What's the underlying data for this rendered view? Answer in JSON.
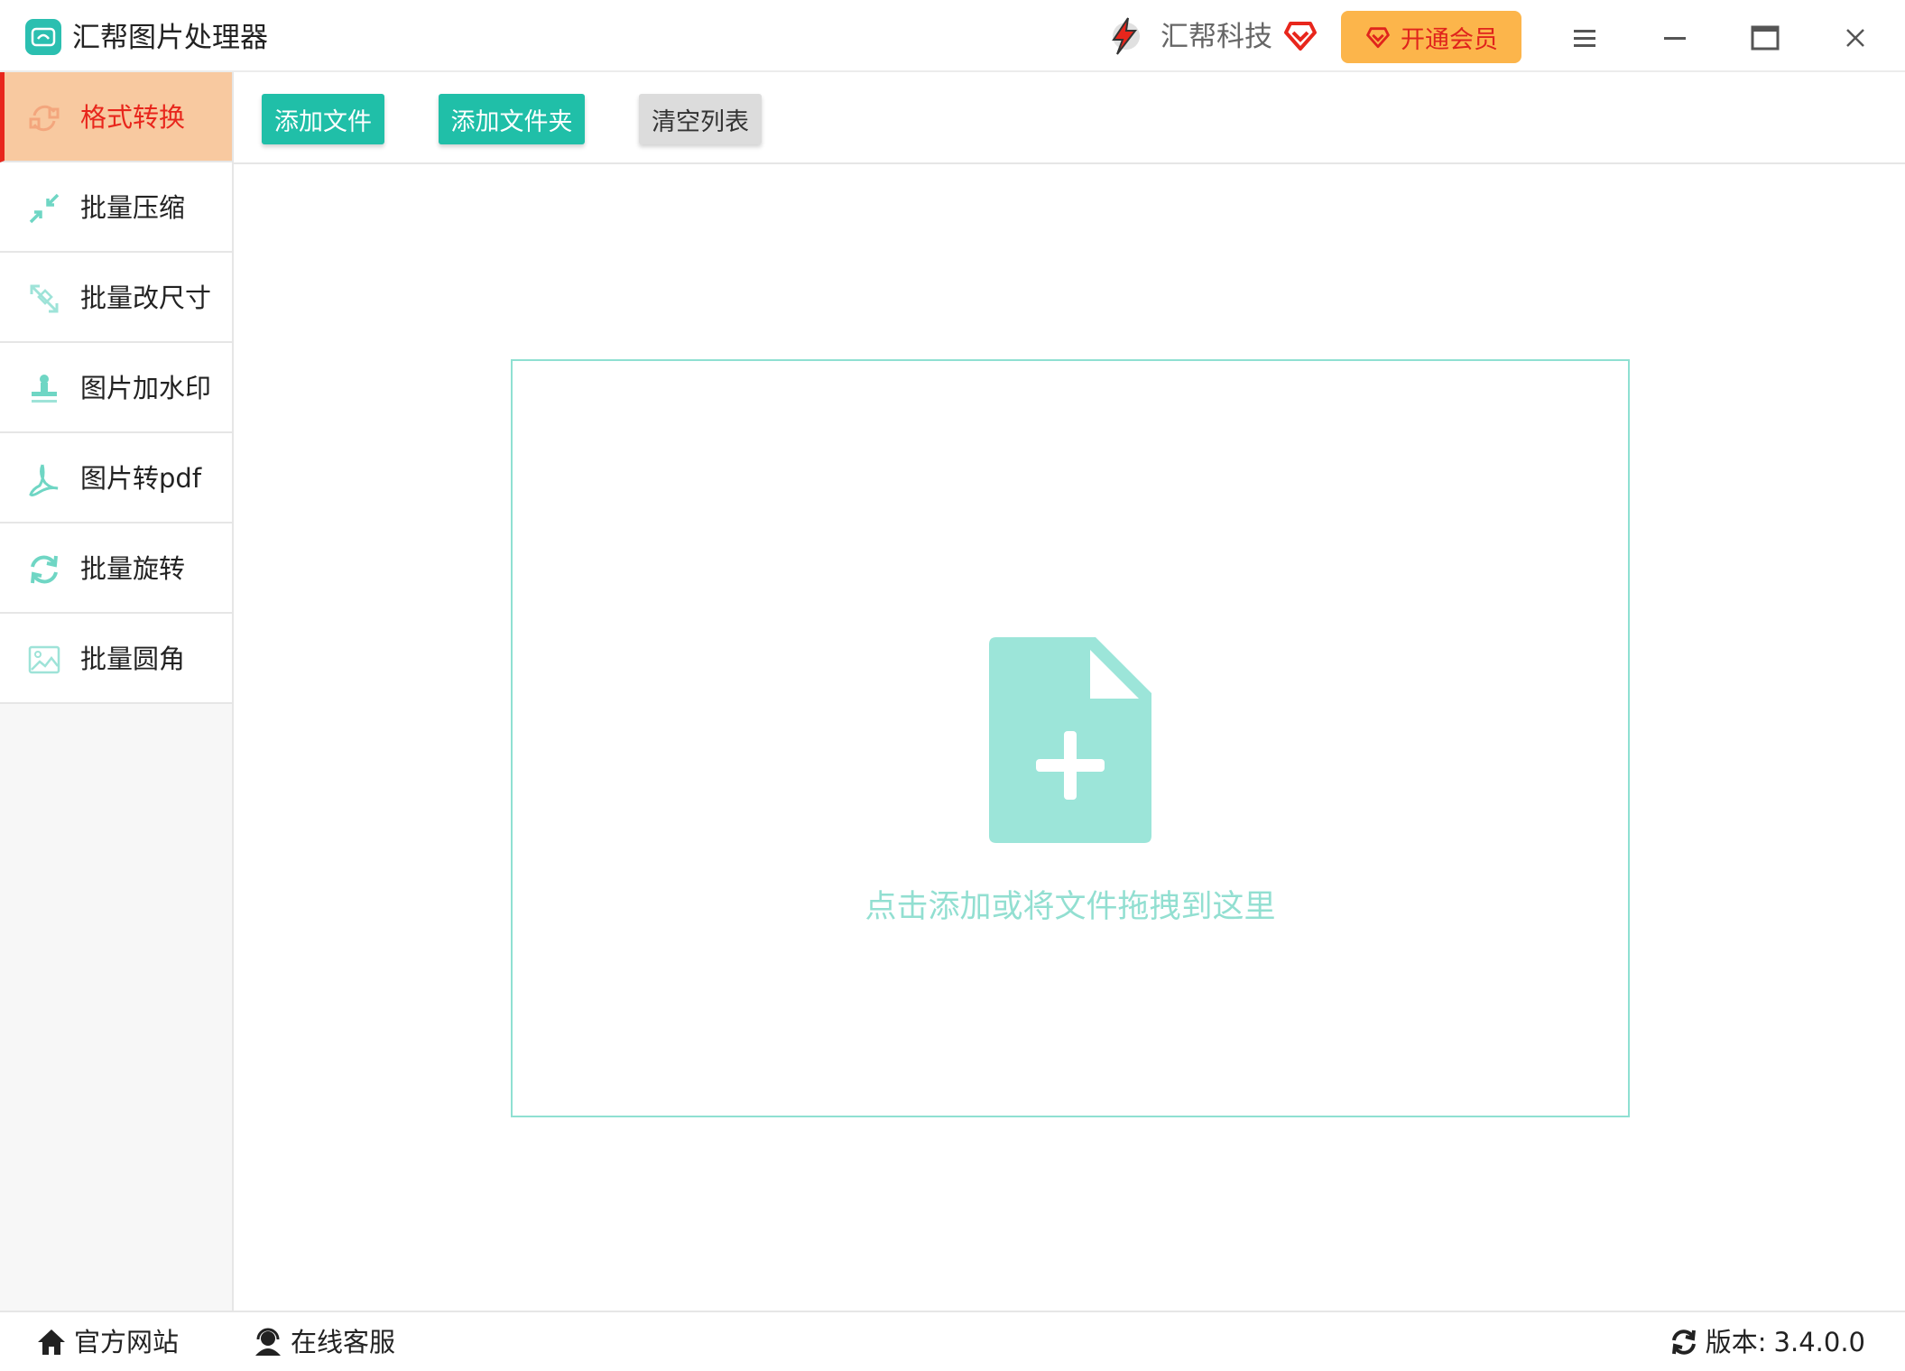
{
  "window": {
    "title": "汇帮图片处理器",
    "brand": "汇帮科技",
    "vip_label": "开通会员"
  },
  "sidebar": {
    "items": [
      {
        "label": "格式转换",
        "icon": "convert-icon",
        "active": true
      },
      {
        "label": "批量压缩",
        "icon": "compress-icon"
      },
      {
        "label": "批量改尺寸",
        "icon": "resize-icon"
      },
      {
        "label": "图片加水印",
        "icon": "watermark-icon"
      },
      {
        "label": "图片转pdf",
        "icon": "pdf-icon"
      },
      {
        "label": "批量旋转",
        "icon": "rotate-icon"
      },
      {
        "label": "批量圆角",
        "icon": "round-corner-icon"
      }
    ]
  },
  "toolbar": {
    "add_file": "添加文件",
    "add_folder": "添加文件夹",
    "clear_list": "清空列表"
  },
  "main": {
    "drop_hint": "点击添加或将文件拖拽到这里"
  },
  "status": {
    "website": "官方网站",
    "support": "在线客服",
    "version_label": "版本:",
    "version": "3.4.0.0"
  },
  "colors": {
    "accent": "#20bfa8",
    "active_bg": "#f8c9a0",
    "active_text": "#e8261c",
    "vip_bg": "#fcb54b",
    "drop_border": "#8fe0d2"
  }
}
